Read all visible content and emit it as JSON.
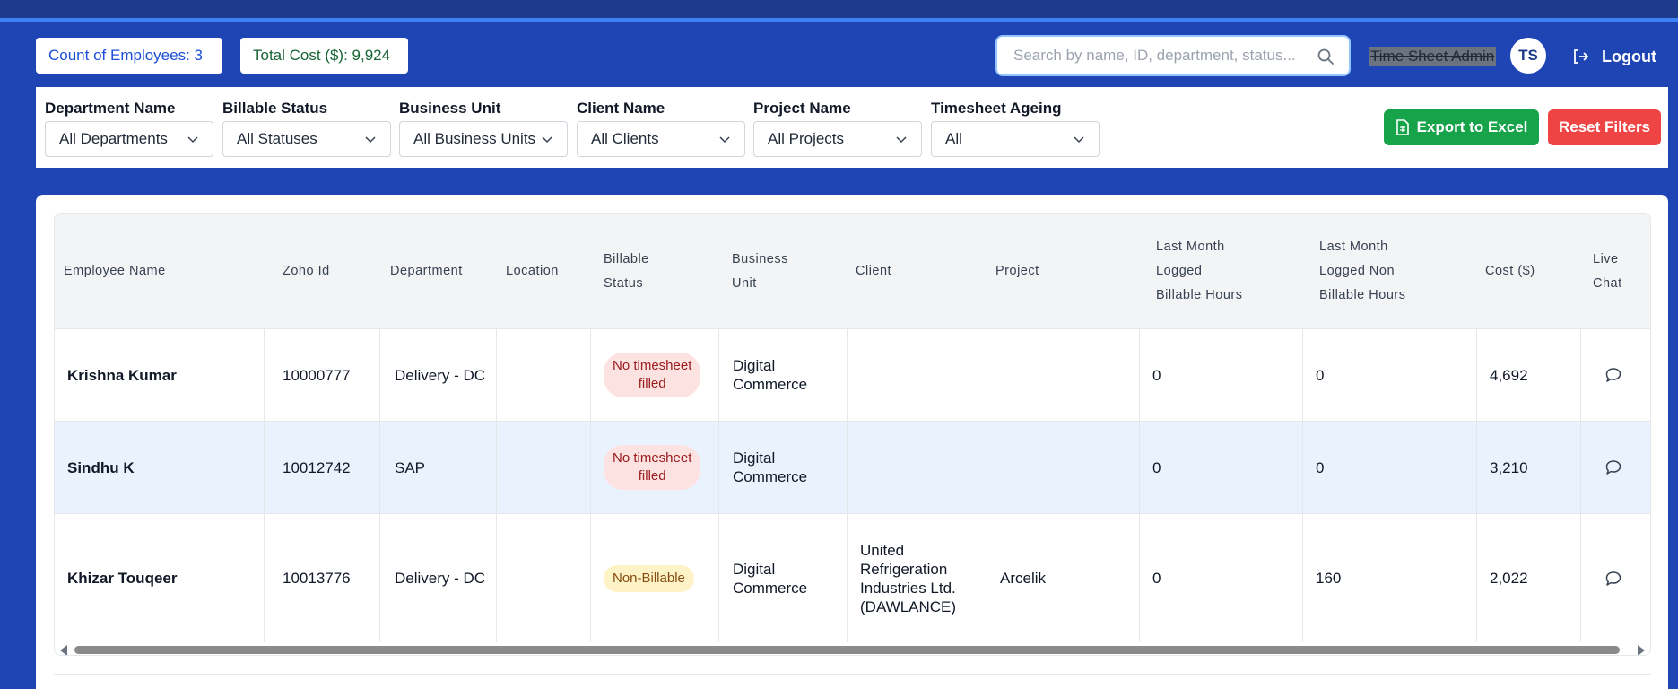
{
  "header": {
    "count_label": "Count of Employees: 3",
    "cost_label": "Total Cost ($): 9,924",
    "search_placeholder": "Search by name, ID, department, status...",
    "admin_label": "Time Sheet Admin",
    "avatar_initials": "TS",
    "logout_label": "Logout"
  },
  "filters": [
    {
      "label": "Department Name",
      "value": "All Departments"
    },
    {
      "label": "Billable Status",
      "value": "All Statuses"
    },
    {
      "label": "Business Unit",
      "value": "All Business Units"
    },
    {
      "label": "Client Name",
      "value": "All Clients"
    },
    {
      "label": "Project Name",
      "value": "All Projects"
    },
    {
      "label": "Timesheet Ageing",
      "value": "All"
    }
  ],
  "buttons": {
    "export": "Export to Excel",
    "reset": "Reset Filters"
  },
  "table": {
    "headers": {
      "employee_name": "Employee Name",
      "zoho_id": "Zoho Id",
      "department": "Department",
      "location": "Location",
      "billable_1": "Billable",
      "billable_2": "Status",
      "bu_1": "Business",
      "bu_2": "Unit",
      "client": "Client",
      "project": "Project",
      "lmb_1": "Last Month",
      "lmb_2": "Logged",
      "lmb_3": "Billable Hours",
      "lmn_1": "Last Month",
      "lmn_2": "Logged Non",
      "lmn_3": "Billable Hours",
      "cost": "Cost ($)",
      "chat_1": "Live",
      "chat_2": "Chat"
    },
    "rows": [
      {
        "name": "Krishna Kumar",
        "zoho_id": "10000777",
        "department": "Delivery - DC",
        "location": "",
        "status_1": "No timesheet",
        "status_2": "filled",
        "bu_1": "Digital",
        "bu_2": "Commerce",
        "client_1": "",
        "client_2": "",
        "client_3": "",
        "client_4": "",
        "project": "",
        "billable_hours": "0",
        "non_billable_hours": "0",
        "cost": "4,692"
      },
      {
        "name": "Sindhu K",
        "zoho_id": "10012742",
        "department": "SAP",
        "location": "",
        "status_1": "No timesheet",
        "status_2": "filled",
        "bu_1": "Digital",
        "bu_2": "Commerce",
        "client_1": "",
        "client_2": "",
        "client_3": "",
        "client_4": "",
        "project": "",
        "billable_hours": "0",
        "non_billable_hours": "0",
        "cost": "3,210"
      },
      {
        "name": "Khizar Touqeer",
        "zoho_id": "10013776",
        "department": "Delivery - DC",
        "location": "",
        "status_1": "Non-Billable",
        "status_2": "",
        "bu_1": "Digital",
        "bu_2": "Commerce",
        "client_1": "United",
        "client_2": "Refrigeration",
        "client_3": "Industries Ltd.",
        "client_4": "(DAWLANCE)",
        "project": "Arcelik",
        "billable_hours": "0",
        "non_billable_hours": "160",
        "cost": "2,022"
      }
    ]
  },
  "colors": {
    "header_bg": "#1f45b5",
    "export_bg": "#16a34a",
    "reset_bg": "#ef4444",
    "badge_red_bg": "#fde2e2",
    "badge_yellow_bg": "#fef3c7"
  }
}
